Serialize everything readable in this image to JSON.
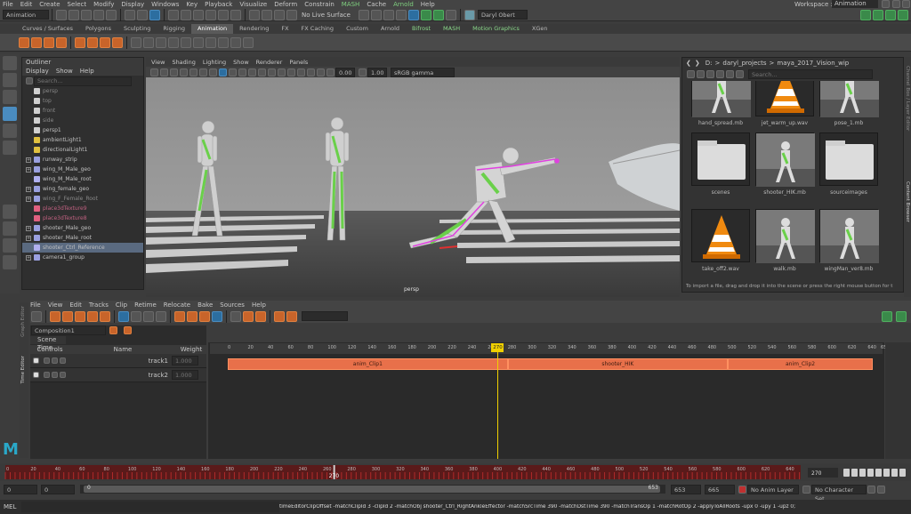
{
  "menubar": {
    "items": [
      "File",
      "Edit",
      "Create",
      "Select",
      "Modify",
      "Display",
      "Windows",
      "Key",
      "Playback",
      "Visualize",
      "Deform",
      "Constrain",
      "MASH",
      "Cache",
      "Arnold",
      "Help"
    ],
    "workspace_label": "Workspace :",
    "workspace_value": "Animation"
  },
  "status": {
    "menuset": "Animation",
    "live_surface": "No Live Surface",
    "user": "Daryl Obert"
  },
  "shelf_tabs": [
    "Curves / Surfaces",
    "Polygons",
    "Sculpting",
    "Rigging",
    "Animation",
    "Rendering",
    "FX",
    "FX Caching",
    "Custom",
    "Arnold",
    "Bifrost",
    "MASH",
    "Motion Graphics",
    "XGen"
  ],
  "shelf_active": "Animation",
  "outliner": {
    "title": "Outliner",
    "menu": [
      "Display",
      "Show",
      "Help"
    ],
    "search_placeholder": "Search...",
    "items": [
      {
        "name": "persp",
        "style": "dim",
        "exp": ""
      },
      {
        "name": "top",
        "style": "dim",
        "exp": ""
      },
      {
        "name": "front",
        "style": "dim",
        "exp": ""
      },
      {
        "name": "side",
        "style": "dim",
        "exp": ""
      },
      {
        "name": "persp1",
        "style": "",
        "exp": ""
      },
      {
        "name": "ambientLight1",
        "style": "",
        "exp": ""
      },
      {
        "name": "directionalLight1",
        "style": "",
        "exp": ""
      },
      {
        "name": "runway_strip",
        "style": "",
        "exp": "+"
      },
      {
        "name": "wing_M_Male_geo",
        "style": "",
        "exp": "+"
      },
      {
        "name": "wing_M_Male_root",
        "style": "",
        "exp": ""
      },
      {
        "name": "wing_female_geo",
        "style": "",
        "exp": "+"
      },
      {
        "name": "wing_F_Female_Root",
        "style": "dim",
        "exp": "+"
      },
      {
        "name": "place3dTexture9",
        "style": "pink",
        "exp": ""
      },
      {
        "name": "place3dTexture8",
        "style": "pink",
        "exp": ""
      },
      {
        "name": "shooter_Male_geo",
        "style": "",
        "exp": "+"
      },
      {
        "name": "shooter_Male_root",
        "style": "",
        "exp": "+"
      },
      {
        "name": "shooter_Ctrl_Reference",
        "style": "sel",
        "exp": ""
      },
      {
        "name": "camera1_group",
        "style": "",
        "exp": "+"
      }
    ]
  },
  "viewport": {
    "menu": [
      "View",
      "Shading",
      "Lighting",
      "Show",
      "Renderer",
      "Panels"
    ],
    "val1": "0.00",
    "val2": "1.00",
    "colorspace": "sRGB gamma",
    "camera_label": "persp"
  },
  "browser": {
    "path": [
      "D:",
      ">",
      "daryl_projects",
      ">",
      "maya_2017_Vision_wip"
    ],
    "search_placeholder": "Search...",
    "files": [
      {
        "name": "hand_spread.mb",
        "kind": "figure"
      },
      {
        "name": "jet_warm_up.wav",
        "kind": "cone"
      },
      {
        "name": "pose_1.mb",
        "kind": "figure"
      },
      {
        "name": "scenes",
        "kind": "folder"
      },
      {
        "name": "shooter_HIK.mb",
        "kind": "figure"
      },
      {
        "name": "sourceimages",
        "kind": "folder"
      },
      {
        "name": "take_off2.wav",
        "kind": "cone"
      },
      {
        "name": "walk.mb",
        "kind": "figure"
      },
      {
        "name": "wingMan_ver8.mb",
        "kind": "figure"
      }
    ],
    "hint": "To import a file, drag and drop it into the scene or press the right mouse button for t"
  },
  "side_tabs": [
    "Channel Box / Layer Editor",
    "Content Browser"
  ],
  "time_editor": {
    "menu": [
      "File",
      "View",
      "Edit",
      "Tracks",
      "Clip",
      "Retime",
      "Relocate",
      "Bake",
      "Sources",
      "Help"
    ],
    "composition": "Composition1",
    "scene_time_label": "Scene Time",
    "columns": {
      "controls": "Controls",
      "name": "Name",
      "weight": "Weight"
    },
    "tracks": [
      {
        "name": "track1",
        "weight": "1.000"
      },
      {
        "name": "track2",
        "weight": "1.000"
      }
    ],
    "ruler_ticks": [
      "0",
      "20",
      "40",
      "60",
      "80",
      "100",
      "120",
      "140",
      "160",
      "180",
      "200",
      "220",
      "240",
      "260",
      "280",
      "300",
      "320",
      "340",
      "360",
      "380",
      "400",
      "420",
      "440",
      "460",
      "480",
      "500",
      "520",
      "540",
      "560",
      "580",
      "600",
      "620",
      "640",
      "653"
    ],
    "playhead": "270",
    "clips": [
      {
        "label": "anim_Clip1",
        "start": 0,
        "end": 280
      },
      {
        "label": "shooter_HIK",
        "start": 280,
        "end": 500
      },
      {
        "label": "anim_Clip2",
        "start": 500,
        "end": 645
      }
    ],
    "panel_tabs": [
      "Graph Editor",
      "Time Editor"
    ]
  },
  "timeslider": {
    "ticks": [
      "0",
      "20",
      "40",
      "60",
      "80",
      "100",
      "120",
      "140",
      "160",
      "180",
      "200",
      "220",
      "240",
      "260",
      "280",
      "300",
      "320",
      "340",
      "360",
      "380",
      "400",
      "420",
      "440",
      "460",
      "480",
      "500",
      "520",
      "540",
      "560",
      "580",
      "600",
      "620",
      "640"
    ],
    "current_frame": "270",
    "frame_field": "270"
  },
  "range": {
    "start": "0",
    "start2": "0",
    "bar_start": "0",
    "bar_end": "653",
    "end": "653",
    "end2": "665",
    "anim_layer": "No Anim Layer",
    "char_set": "No Character Set"
  },
  "cmdline": {
    "lang": "MEL",
    "text": "timeEditorClipOffset -matchClipId 3 -clipId 2 -matchObj shooter_Ctrl_RightAnkleEffector -matchSrcTime 390 -matchDstTime 390 -matchTransOp 1 -matchRotOp 2 -applyToAllRoots -upx 0 -upy 1 -upz 0;"
  }
}
